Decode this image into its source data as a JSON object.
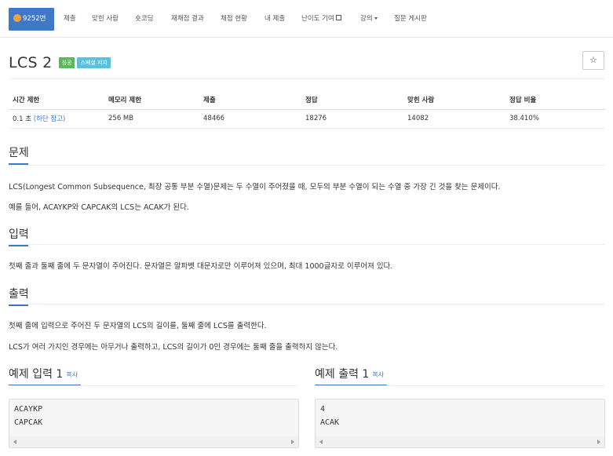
{
  "nav": {
    "items": [
      {
        "label": "9252번",
        "active": true
      },
      {
        "label": "제출"
      },
      {
        "label": "맞힌 사람"
      },
      {
        "label": "숏코딩"
      },
      {
        "label": "재채점 결과"
      },
      {
        "label": "채점 현황"
      },
      {
        "label": "내 제출"
      },
      {
        "label": "난이도 기여"
      },
      {
        "label": "강의"
      },
      {
        "label": "질문 게시판"
      }
    ]
  },
  "problem": {
    "title": "LCS 2",
    "labels": [
      "성공",
      "스페셜 저지"
    ],
    "star": "☆"
  },
  "info": {
    "headers": [
      "시간 제한",
      "메모리 제한",
      "제출",
      "정답",
      "맞힌 사람",
      "정답 비율"
    ],
    "time_limit": "0.1 초",
    "time_hint": "(하단 참고)",
    "values": [
      "256 MB",
      "48466",
      "18276",
      "14082",
      "38.410%"
    ]
  },
  "sections": {
    "problem_title": "문제",
    "problem_p1": "LCS(Longest Common Subsequence, 최장 공통 부분 수열)문제는 두 수열이 주어졌을 때, 모두의 부분 수열이 되는 수열 중 가장 긴 것을 찾는 문제이다.",
    "problem_p2": "예를 들어, ACAYKP와 CAPCAK의 LCS는 ACAK가 된다.",
    "input_title": "입력",
    "input_p1": "첫째 줄과 둘째 줄에 두 문자열이 주어진다. 문자열은 알파벳 대문자로만 이루어져 있으며, 최대 1000글자로 이루어져 있다.",
    "output_title": "출력",
    "output_p1": "첫째 줄에 입력으로 주어진 두 문자열의 LCS의 길이를, 둘째 줄에 LCS를 출력한다.",
    "output_p2": "LCS가 여러 가지인 경우에는 아무거나 출력하고, LCS의 길이가 0인 경우에는 둘째 줄을 출력하지 않는다."
  },
  "samples": {
    "input_title": "예제 입력 1",
    "output_title": "예제 출력 1",
    "copy_label": "복사",
    "input_lines": [
      "ACAYKP",
      "CAPCAK"
    ],
    "output_lines": [
      "4",
      "ACAK"
    ]
  }
}
